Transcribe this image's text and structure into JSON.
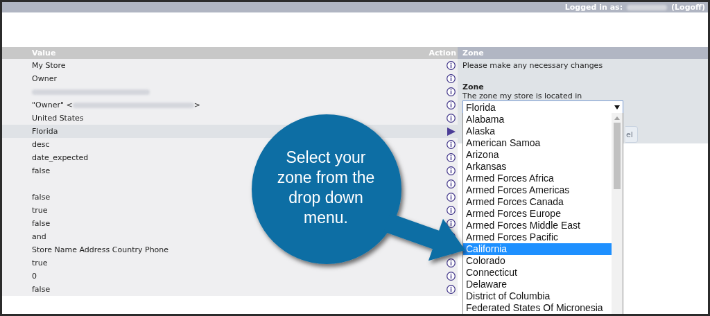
{
  "top_bar": {
    "label": "Logged in as:",
    "logoff": "(Logoff)"
  },
  "table": {
    "columns": [
      "Value",
      "Action"
    ],
    "rows": [
      {
        "kind": "text",
        "value": "My Store",
        "selected": false
      },
      {
        "kind": "text",
        "value": "Owner",
        "selected": false
      },
      {
        "kind": "redacted",
        "selected": false
      },
      {
        "kind": "email",
        "prefix": "\"Owner\" <",
        "suffix": ">",
        "selected": false
      },
      {
        "kind": "text",
        "value": "United States",
        "selected": false
      },
      {
        "kind": "text",
        "value": "Florida",
        "selected": true
      },
      {
        "kind": "text",
        "value": "desc",
        "selected": false
      },
      {
        "kind": "text",
        "value": "date_expected",
        "selected": false
      },
      {
        "kind": "text",
        "value": "false",
        "selected": false
      },
      {
        "kind": "blank",
        "selected": false
      },
      {
        "kind": "text",
        "value": "false",
        "selected": false
      },
      {
        "kind": "text",
        "value": "true",
        "selected": false
      },
      {
        "kind": "text",
        "value": "false",
        "selected": false
      },
      {
        "kind": "text",
        "value": "and",
        "selected": false
      },
      {
        "kind": "text",
        "value": "Store Name Address Country Phone",
        "selected": false
      },
      {
        "kind": "text",
        "value": "true",
        "selected": false
      },
      {
        "kind": "text",
        "value": "0",
        "selected": false
      },
      {
        "kind": "text",
        "value": "false",
        "selected": false
      }
    ]
  },
  "panel": {
    "title": "Zone",
    "message": "Please make any necessary changes",
    "field_label": "Zone",
    "field_hint": "The zone my store is located in",
    "select": {
      "value": "Florida",
      "expanded": true,
      "options": [
        {
          "label": "Alabama",
          "selected": false
        },
        {
          "label": "Alaska",
          "selected": false
        },
        {
          "label": "American Samoa",
          "selected": false
        },
        {
          "label": "Arizona",
          "selected": false
        },
        {
          "label": "Arkansas",
          "selected": false
        },
        {
          "label": "Armed Forces Africa",
          "selected": false
        },
        {
          "label": "Armed Forces Americas",
          "selected": false
        },
        {
          "label": "Armed Forces Canada",
          "selected": false
        },
        {
          "label": "Armed Forces Europe",
          "selected": false
        },
        {
          "label": "Armed Forces Middle East",
          "selected": false
        },
        {
          "label": "Armed Forces Pacific",
          "selected": false
        },
        {
          "label": "California",
          "selected": true
        },
        {
          "label": "Colorado",
          "selected": false
        },
        {
          "label": "Connecticut",
          "selected": false
        },
        {
          "label": "Delaware",
          "selected": false
        },
        {
          "label": "District of Columbia",
          "selected": false
        },
        {
          "label": "Federated States Of Micronesia",
          "selected": false
        }
      ]
    },
    "button_stub": "el"
  },
  "callout": {
    "text": "Select your zone from the drop down menu."
  }
}
